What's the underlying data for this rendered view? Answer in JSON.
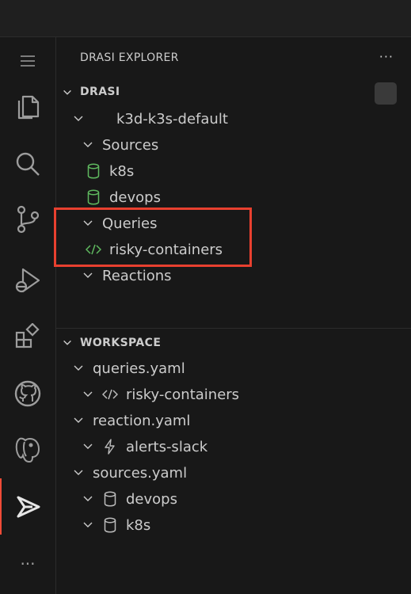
{
  "explorer": {
    "header": "DRASI EXPLORER",
    "more": "···",
    "section": "DRASI",
    "cluster": "k3d-k3s-default",
    "sources_label": "Sources",
    "sources": [
      "k8s",
      "devops"
    ],
    "queries_label": "Queries",
    "queries": [
      "risky-containers"
    ],
    "reactions_label": "Reactions"
  },
  "workspace": {
    "section": "WORKSPACE",
    "files": [
      {
        "name": "queries.yaml",
        "child": "risky-containers",
        "icon": "code-icon"
      },
      {
        "name": "reaction.yaml",
        "child": "alerts-slack",
        "icon": "lightning-icon"
      },
      {
        "name": "sources.yaml",
        "children": [
          "devops",
          "k8s"
        ],
        "icon": "database-icon"
      }
    ]
  },
  "activity_bar": {
    "items": [
      "menu-icon",
      "files-icon",
      "search-icon",
      "source-control-icon",
      "run-debug-icon",
      "extensions-icon",
      "github-icon",
      "postgres-icon",
      "drasi-icon",
      "more-icon"
    ],
    "more_label": "···"
  },
  "colors": {
    "accent_green": "#5fb95f",
    "highlight_red": "#e8402f",
    "active_bar": "#f04b37"
  }
}
